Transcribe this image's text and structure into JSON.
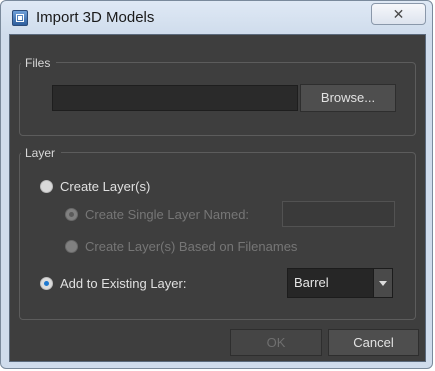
{
  "window": {
    "title": "Import 3D Models",
    "close_glyph": "✕",
    "icon": "app-icon"
  },
  "files": {
    "group_label": "Files",
    "path_value": "",
    "browse_label": "Browse..."
  },
  "layer": {
    "group_label": "Layer",
    "create_layers": {
      "label": "Create Layer(s)",
      "selected": false,
      "enabled": true
    },
    "create_single": {
      "label": "Create Single Layer Named:",
      "selected": true,
      "enabled": false,
      "value": ""
    },
    "create_by_filenames": {
      "label": "Create Layer(s) Based on Filenames",
      "selected": false,
      "enabled": false
    },
    "add_existing": {
      "label": "Add to Existing Layer:",
      "selected": true,
      "enabled": true
    },
    "existing_layer_select": {
      "value": "Barrel"
    }
  },
  "buttons": {
    "ok_label": "OK",
    "ok_enabled": false,
    "cancel_label": "Cancel"
  },
  "colors": {
    "dialog_bg": "#3e3e3e",
    "radio_accent": "#1e79d0",
    "title_bar": "#cfdcec"
  }
}
